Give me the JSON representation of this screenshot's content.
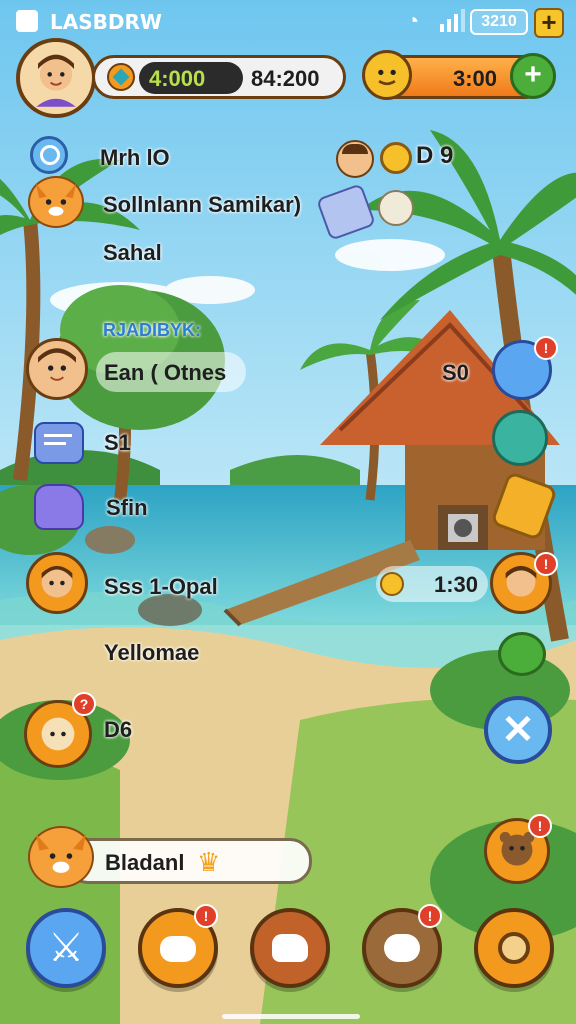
{
  "status_bar": {
    "carrier": "LASBDRW",
    "battery_text": "3210"
  },
  "top_bar": {
    "resource_value": "4:000",
    "resource_secondary": "84:200",
    "timer_value": "3:00"
  },
  "side_panel": {
    "items": [
      {
        "label": "Mrh lO"
      },
      {
        "label": "Sollnlann Samikar)"
      },
      {
        "label": "Sahal"
      },
      {
        "label": "RJADIBYK:"
      },
      {
        "label": "Ean ( Otnes"
      },
      {
        "label": "S1"
      },
      {
        "label": "Sfin"
      },
      {
        "label": "Sss 1-Opal"
      },
      {
        "label": "Yellomae"
      },
      {
        "label": "D6"
      }
    ]
  },
  "right_panel": {
    "coin_label": "D 9",
    "value_1": "S0",
    "value_2": "1:30"
  },
  "chat_bar": {
    "text": "Bladanl"
  },
  "colors": {
    "sky": "#8fd3f0",
    "sea": "#3fb8c9",
    "sand": "#e8cf98",
    "grass": "#7cb84a",
    "accent_orange": "#f39a1e",
    "accent_green": "#4cae3a"
  },
  "icons": {
    "add": "plus-icon",
    "search": "search-icon",
    "nav": [
      "sword-icon",
      "cat-icon",
      "wolf-icon",
      "dog-icon",
      "shield-icon"
    ]
  }
}
